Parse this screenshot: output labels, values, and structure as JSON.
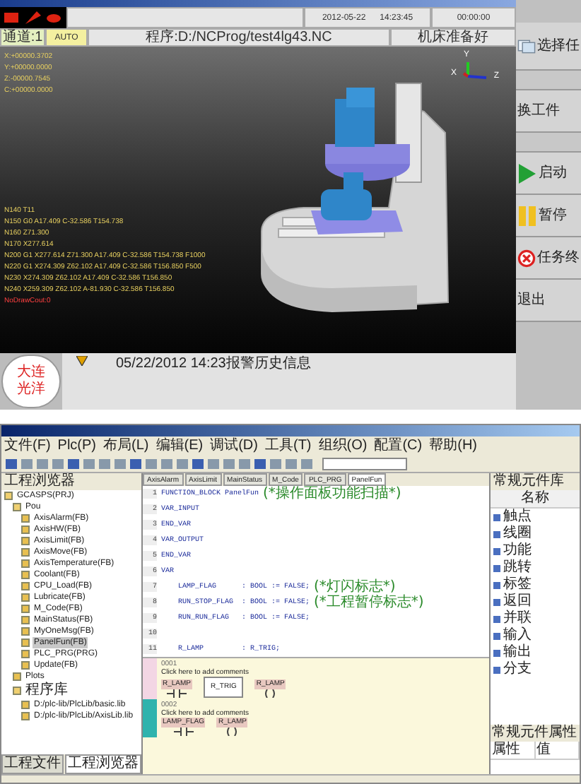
{
  "cnc": {
    "status": {
      "date": "2012-05-22",
      "time": "14:23:45",
      "run_time": "00:00:00"
    },
    "info_bar": {
      "channel": "通道:1",
      "mode": "AUTO",
      "program": "程序:D:/NCProg/test4lg43.NC",
      "machine_state": "机床准备好"
    },
    "coordinates": [
      "X:+00000.3702",
      "Y:+00000.0000",
      "Z:-00000.7545",
      "C:+00000.0000"
    ],
    "axes": {
      "x": "X",
      "y": "Y",
      "z": "Z"
    },
    "program_lines": [
      {
        "text": "N140 T11",
        "kind": "block"
      },
      {
        "text": "N150 G0 A17.409 C-32.586 T154.738",
        "kind": "block"
      },
      {
        "text": "N160 Z71.300",
        "kind": "block"
      },
      {
        "text": "N170 X277.614",
        "kind": "block"
      },
      {
        "text": "N200 G1 X277.614 Z71.300 A17.409 C-32.586 T154.738 F1000",
        "kind": "block"
      },
      {
        "text": "N220 G1 X274.309 Z62.102 A17.409 C-32.586 T156.850 F500",
        "kind": "block"
      },
      {
        "text": "N230 X274.309 Z62.102 A17.409 C-32.586 T156.850",
        "kind": "block"
      },
      {
        "text": "N240 X259.309 Z62.102 A-81.930 C-32.586 T156.850",
        "kind": "block"
      },
      {
        "text": "NoDrawCout:0",
        "kind": "status"
      }
    ],
    "alarm": {
      "message": "05/22/2012 14:23报警历史信息"
    },
    "logo": "大连光洋",
    "side_buttons": [
      {
        "kind": "select",
        "label": "选择任"
      },
      {
        "kind": "blank"
      },
      {
        "kind": "text",
        "label": "换工件"
      },
      {
        "kind": "blank"
      },
      {
        "kind": "start",
        "label": "启动"
      },
      {
        "kind": "pause",
        "label": "暂停"
      },
      {
        "kind": "cancel",
        "label": "任务终"
      },
      {
        "kind": "text",
        "label": "退出"
      }
    ]
  },
  "ide": {
    "menu": [
      "文件(F)",
      "Plc(P)",
      "布局(L)",
      "编辑(E)",
      "调试(D)",
      "工具(T)",
      "组织(O)",
      "配置(C)",
      "帮助(H)"
    ],
    "tree_title": "工程浏览器",
    "tree": [
      {
        "label": "GCASPS(PRJ)",
        "selected": false,
        "children": [
          {
            "label": "Pou",
            "selected": false,
            "children": [
              {
                "label": "AxisAlarm(FB)",
                "selected": false
              },
              {
                "label": "AxisHW(FB)",
                "selected": false
              },
              {
                "label": "AxisLimit(FB)",
                "selected": false
              },
              {
                "label": "AxisMove(FB)",
                "selected": false
              },
              {
                "label": "AxisTemperature(FB)",
                "selected": false
              },
              {
                "label": "Coolant(FB)",
                "selected": false
              },
              {
                "label": "CPU_Load(FB)",
                "selected": false
              },
              {
                "label": "Lubricate(FB)",
                "selected": false
              },
              {
                "label": "M_Code(FB)",
                "selected": false
              },
              {
                "label": "MainStatus(FB)",
                "selected": false
              },
              {
                "label": "MyOneMsg(FB)",
                "selected": false
              },
              {
                "label": "PanelFun(FB)",
                "selected": true
              },
              {
                "label": "PLC_PRG(PRG)",
                "selected": false
              },
              {
                "label": "Update(FB)",
                "selected": false
              }
            ]
          },
          {
            "label": "Plots",
            "selected": false
          },
          {
            "label": "程序库",
            "selected": false,
            "children": [
              {
                "label": "D:/plc-lib/PlcLib/basic.lib",
                "selected": false
              },
              {
                "label": "D:/plc-lib/PlcLib/AxisLib.lib",
                "selected": false
              }
            ]
          }
        ]
      }
    ],
    "tree_tabs": [
      {
        "label": "工程文件",
        "selected": false
      },
      {
        "label": "工程浏览器",
        "selected": true
      }
    ],
    "editor_tabs": [
      {
        "label": "AxisAlarm",
        "selected": false
      },
      {
        "label": "AxisLimit",
        "selected": false
      },
      {
        "label": "MainStatus",
        "selected": false
      },
      {
        "label": "M_Code",
        "selected": false
      },
      {
        "label": "PLC_PRG",
        "selected": false
      },
      {
        "label": "PanelFun",
        "selected": true
      }
    ],
    "code": [
      {
        "number": "1",
        "text": "FUNCTION_BLOCK PanelFun",
        "comment": "(*操作面板功能扫描*)"
      },
      {
        "number": "2",
        "text": "VAR_INPUT"
      },
      {
        "number": "3",
        "text": "END_VAR"
      },
      {
        "number": "4",
        "text": "VAR_OUTPUT"
      },
      {
        "number": "5",
        "text": "END_VAR"
      },
      {
        "number": "6",
        "text": "VAR"
      },
      {
        "number": "7",
        "text": "    LAMP_FLAG      : BOOL := FALSE;",
        "comment": "(*灯闪标志*)"
      },
      {
        "number": "8",
        "text": "    RUN_STOP_FLAG  : BOOL := FALSE;",
        "comment": "(*工程暂停标志*)"
      },
      {
        "number": "9",
        "text": "    RUN_RUN_FLAG   : BOOL := FALSE;"
      },
      {
        "number": "10"
      },
      {
        "number": "11",
        "text": "    R_LAMP         : R_TRIG;"
      }
    ],
    "ladder": [
      {
        "number": "0001",
        "comment": "Click here to add comments",
        "color": "#f3d6e4",
        "elements": [
          {
            "kind": "contact",
            "label": "R_LAMP"
          },
          {
            "kind": "block",
            "label": "R_TRIG"
          },
          {
            "kind": "coil",
            "label": "R_LAMP"
          }
        ]
      },
      {
        "number": "0002",
        "comment": "Click here to add comments",
        "color": "#2fb3ad",
        "elements": [
          {
            "kind": "contact",
            "label": "LAMP_FLAG"
          },
          {
            "kind": "coil",
            "label": "R_LAMP"
          }
        ]
      }
    ],
    "library": {
      "title": "常规元件库",
      "column": "名称",
      "items": [
        "触点",
        "线圈",
        "功能",
        "跳转",
        "标签",
        "返回",
        "并联",
        "输入",
        "输出",
        "分支"
      ]
    },
    "properties": {
      "title": "常规元件属性",
      "columns": [
        "属性",
        "值"
      ]
    }
  }
}
